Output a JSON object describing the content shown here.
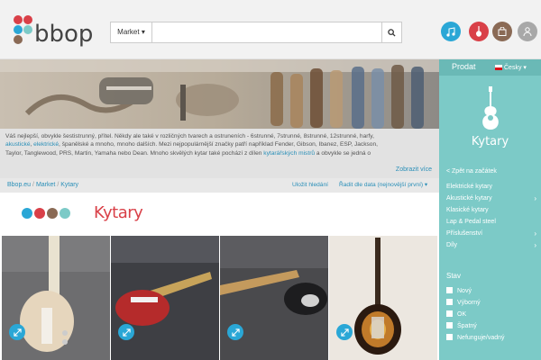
{
  "header": {
    "logo_text": "bbop",
    "search": {
      "category_label": "Market ▾",
      "placeholder": ""
    }
  },
  "description": {
    "text1": "Váš nejlepší, obvykle šestistrunný, přítel. Někdy ale také v rozličných tvarech a ostruneních - 6strunné, 7strunné, 8strunné, 12strunné, harfy,",
    "link_akusticke": "akustické",
    "sep1": ", ",
    "link_elektricke": "elektrické",
    "text2": ", španělské a mnoho, mnoho dalších. Mezi nejpopulárnější značky patří například Fender, Gibson, Ibanez, ESP, Jackson,",
    "text3": "Taylor, Tanglewood, PRS, Martin, Yamaha nebo Dean. Mnoho skvělých kytar také pochází z dílen",
    "link_mistri": "kytarářských mistrů",
    "text4": "a obvykle se jedná o",
    "show_more": "Zobrazit více"
  },
  "breadcrumb": {
    "items": [
      "Bbop.eu",
      "Market",
      "Kytary"
    ],
    "separator": "/",
    "save_search": "Uložit hledání",
    "sort": "Řadit dle data (nejnovější první) ▾"
  },
  "category_title": "Kytary",
  "sidebar": {
    "sell": "Prodat",
    "language": "Česky ▾",
    "category": "Kytary",
    "back": "< Zpět na začátek",
    "menu": [
      {
        "label": "Elektrické kytary",
        "arrow": ""
      },
      {
        "label": "Akustické kytary",
        "arrow": "›"
      },
      {
        "label": "Klasické kytary",
        "arrow": ""
      },
      {
        "label": "Lap & Pedal steel",
        "arrow": ""
      },
      {
        "label": "Příslušenství",
        "arrow": "›"
      },
      {
        "label": "Díly",
        "arrow": "›"
      }
    ],
    "condition_title": "Stav",
    "conditions": [
      "Nový",
      "Výborný",
      "OK",
      "Špatný",
      "Nefunguje/vadný"
    ]
  },
  "colors": {
    "accent_teal": "#7ccac7",
    "brand_red": "#d94048",
    "link_blue": "#2a8fb8",
    "logo_dots": [
      "#d94048",
      "#2aa7d6",
      "#8a6a55",
      "#7ccac7"
    ]
  },
  "icons": [
    "search-icon",
    "music-note-icon",
    "guitar-icon",
    "bag-icon",
    "user-icon",
    "zoom-icon",
    "guitar-category-icon"
  ]
}
